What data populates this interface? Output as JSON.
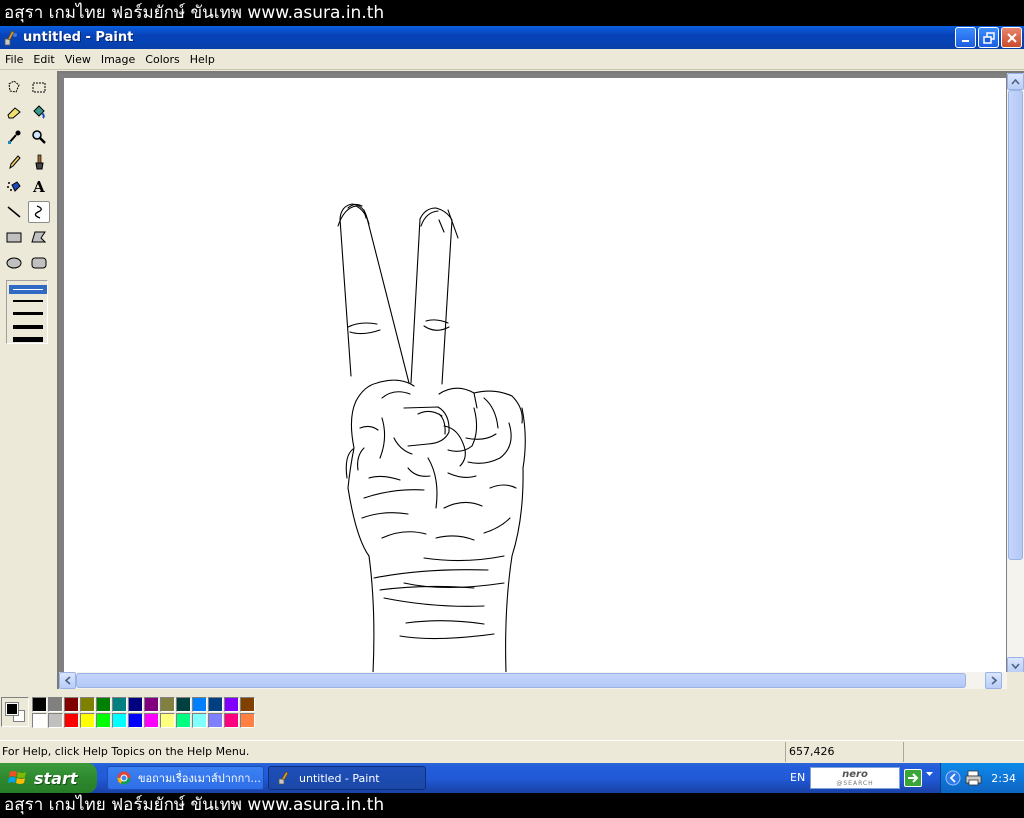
{
  "watermark": {
    "text": "อสุรา เกมไทย ฟอร์มยักษ์ ขันเทพ www.asura.in.th"
  },
  "window": {
    "title": "untitled - Paint"
  },
  "menu": {
    "items": [
      "File",
      "Edit",
      "View",
      "Image",
      "Colors",
      "Help"
    ]
  },
  "toolbox": {
    "tools": [
      {
        "name": "free-form-select"
      },
      {
        "name": "select"
      },
      {
        "name": "eraser"
      },
      {
        "name": "fill-with-color"
      },
      {
        "name": "pick-color"
      },
      {
        "name": "magnifier"
      },
      {
        "name": "pencil"
      },
      {
        "name": "brush"
      },
      {
        "name": "airbrush"
      },
      {
        "name": "text"
      },
      {
        "name": "line"
      },
      {
        "name": "curve"
      },
      {
        "name": "rectangle"
      },
      {
        "name": "polygon"
      },
      {
        "name": "ellipse"
      },
      {
        "name": "rounded-rectangle"
      }
    ],
    "active_tool": "curve",
    "text_tool_glyph": "A"
  },
  "palette": {
    "foreground": "#000000",
    "background": "#ffffff",
    "colors": [
      "#000000",
      "#808080",
      "#800000",
      "#808000",
      "#008000",
      "#008080",
      "#000080",
      "#800080",
      "#808040",
      "#004040",
      "#0080ff",
      "#004080",
      "#8000ff",
      "#804000",
      "#ffffff",
      "#c0c0c0",
      "#ff0000",
      "#ffff00",
      "#00ff00",
      "#00ffff",
      "#0000ff",
      "#ff00ff",
      "#ffff80",
      "#00ff80",
      "#80ffff",
      "#8080ff",
      "#ff0080",
      "#ff8040"
    ]
  },
  "status": {
    "help_text": "For Help, click Help Topics on the Help Menu.",
    "coordinates": "657,426"
  },
  "taskbar": {
    "start_label": "start",
    "tasks": [
      {
        "label": "ขอถามเรื่องเมาส์ปากกา..."
      },
      {
        "label": "untitled - Paint"
      }
    ],
    "language": "EN",
    "nero_label": "nero",
    "nero_sub": "@SEARCH",
    "clock": "2:34"
  },
  "colors": {
    "titlebar": "#0a5fe0",
    "taskbar": "#245edb",
    "start": "#2f8b2f"
  }
}
